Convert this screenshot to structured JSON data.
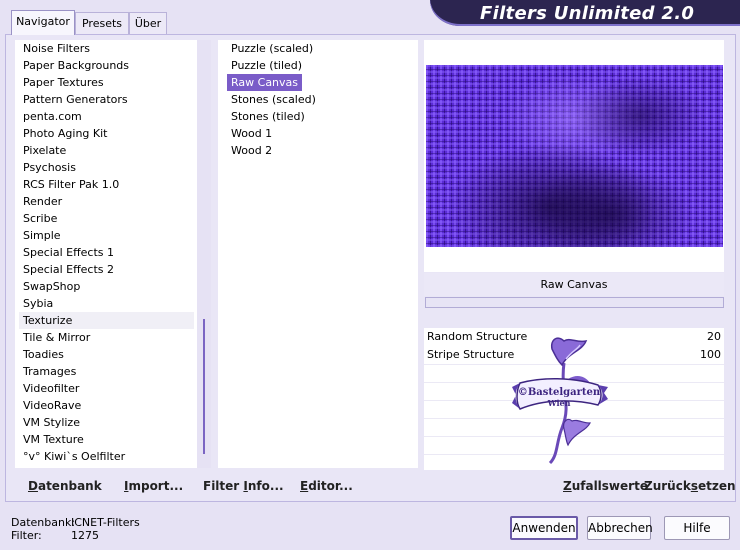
{
  "window": {
    "title": "Filters Unlimited 2.0"
  },
  "tabs": [
    {
      "label": "Navigator",
      "active": true
    },
    {
      "label": "Presets",
      "active": false
    },
    {
      "label": "Über",
      "active": false
    }
  ],
  "categories": {
    "items": [
      "Noise Filters",
      "Paper Backgrounds",
      "Paper Textures",
      "Pattern Generators",
      "penta.com",
      "Photo Aging Kit",
      "Pixelate",
      "Psychosis",
      "RCS Filter Pak 1.0",
      "Render",
      "Scribe",
      "Simple",
      "Special Effects 1",
      "Special Effects 2",
      "SwapShop",
      "Sybia",
      "Texturize",
      "Tile & Mirror",
      "Toadies",
      "Tramages",
      "Videofilter",
      "VideoRave",
      "VM Stylize",
      "VM Texture",
      "°v° Kiwi`s Oelfilter"
    ],
    "selected": "Texturize"
  },
  "filters": {
    "items": [
      "Puzzle (scaled)",
      "Puzzle (tiled)",
      "Raw Canvas",
      "Stones (scaled)",
      "Stones (tiled)",
      "Wood 1",
      "Wood 2"
    ],
    "selected": "Raw Canvas"
  },
  "preview": {
    "filter_name": "Raw Canvas",
    "color_accent": "#5a2bd6"
  },
  "parameters": [
    {
      "name": "Random Structure",
      "value": "20"
    },
    {
      "name": "Stripe Structure",
      "value": "100"
    }
  ],
  "watermark": {
    "line1": "©Bastelgarten",
    "line2": "Wien"
  },
  "bottom_links": {
    "database": {
      "label": "Datenbank",
      "underline": "D",
      "rest": "atenbank"
    },
    "import": {
      "label": "Import...",
      "underline": "I",
      "rest": "mport..."
    },
    "filter_info": {
      "label": "Filter Info...",
      "pre": "Filter ",
      "underline": "I",
      "rest": "nfo..."
    },
    "editor": {
      "label": "Editor...",
      "underline": "E",
      "rest": "ditor..."
    },
    "randomize": {
      "label": "Zufallswerte",
      "underline": "Z",
      "rest": "ufallswerte"
    },
    "reset": {
      "label": "Zurücksetzen",
      "pre": "Zurück",
      "underline": "s",
      "rest": "etzen"
    }
  },
  "status": {
    "database_label": "Datenbank:",
    "database_value": "ICNET-Filters",
    "filter_label": "Filter:",
    "filter_value": "1275"
  },
  "buttons": {
    "apply": "Anwenden",
    "cancel": "Abbrechen",
    "help": "Hilfe"
  }
}
